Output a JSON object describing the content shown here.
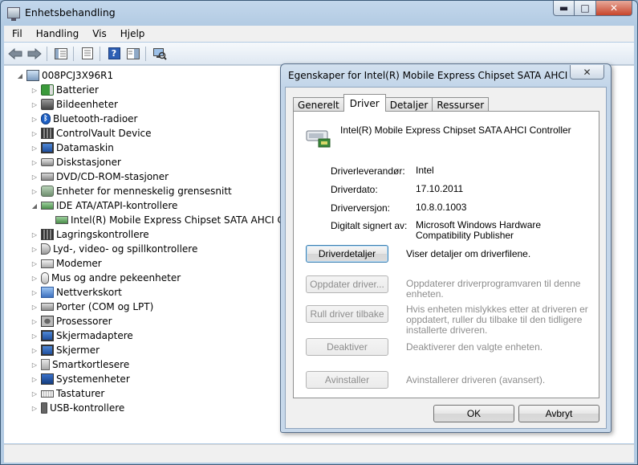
{
  "window": {
    "title": "Enhetsbehandling",
    "controls": {
      "minimize": "▬",
      "maximize": "□",
      "close": "✕"
    }
  },
  "menu": [
    "Fil",
    "Handling",
    "Vis",
    "Hjelp"
  ],
  "toolbar": [
    "back-arrow-icon",
    "forward-arrow-icon",
    "console-tree-icon",
    "properties-icon",
    "help-icon",
    "action-pane-icon",
    "scan-hardware-icon"
  ],
  "tree": {
    "root": "008PCJ3X96R1",
    "items": [
      {
        "label": "Batterier",
        "icon": "battery-icon"
      },
      {
        "label": "Bildeenheter",
        "icon": "camera-icon"
      },
      {
        "label": "Bluetooth-radioer",
        "icon": "bluetooth-icon"
      },
      {
        "label": "ControlVault Device",
        "icon": "chip-icon"
      },
      {
        "label": "Datamaskin",
        "icon": "monitor-icon"
      },
      {
        "label": "Diskstasjoner",
        "icon": "disk-drive-icon"
      },
      {
        "label": "DVD/CD-ROM-stasjoner",
        "icon": "dvd-drive-icon"
      },
      {
        "label": "Enheter for menneskelig grensesnitt",
        "icon": "hid-icon"
      },
      {
        "label": "IDE ATA/ATAPI-kontrollere",
        "icon": "ide-controller-icon",
        "expanded": true
      },
      {
        "label": "Intel(R) Mobile Express Chipset SATA AHCI Controller",
        "icon": "sata-controller-icon",
        "child": true
      },
      {
        "label": "Lagringskontrollere",
        "icon": "storage-controller-icon"
      },
      {
        "label": "Lyd-, video- og spillkontrollere",
        "icon": "speaker-icon"
      },
      {
        "label": "Modemer",
        "icon": "modem-icon"
      },
      {
        "label": "Mus og andre pekeenheter",
        "icon": "mouse-icon"
      },
      {
        "label": "Nettverkskort",
        "icon": "network-adapter-icon"
      },
      {
        "label": "Porter (COM og LPT)",
        "icon": "port-icon"
      },
      {
        "label": "Prosessorer",
        "icon": "processor-icon"
      },
      {
        "label": "Skjermadaptere",
        "icon": "display-adapter-icon"
      },
      {
        "label": "Skjermer",
        "icon": "monitor-icon"
      },
      {
        "label": "Smartkortlesere",
        "icon": "smartcard-reader-icon"
      },
      {
        "label": "Systemenheter",
        "icon": "system-devices-icon"
      },
      {
        "label": "Tastaturer",
        "icon": "keyboard-icon"
      },
      {
        "label": "USB-kontrollere",
        "icon": "usb-icon"
      }
    ]
  },
  "dialog": {
    "title": "Egenskaper for Intel(R) Mobile Express Chipset SATA AHCI Cont...",
    "close": "✕",
    "tabs": [
      "Generelt",
      "Driver",
      "Detaljer",
      "Ressurser"
    ],
    "active_tab": "Driver",
    "device_name": "Intel(R) Mobile Express Chipset SATA AHCI Controller",
    "properties": [
      {
        "label": "Driverleverandør:",
        "value": "Intel"
      },
      {
        "label": "Driverdato:",
        "value": "17.10.2011"
      },
      {
        "label": "Driverversjon:",
        "value": "10.8.0.1003"
      },
      {
        "label": "Digitalt signert av:",
        "value": "Microsoft Windows Hardware Compatibility Publisher"
      }
    ],
    "actions": [
      {
        "button": "Driverdetaljer",
        "desc": "Viser detaljer om driverfilene.",
        "enabled": true
      },
      {
        "button": "Oppdater driver...",
        "desc": "Oppdaterer driverprogramvaren til denne enheten.",
        "enabled": false
      },
      {
        "button": "Rull driver tilbake",
        "desc": "Hvis enheten mislykkes etter at driveren er oppdatert, ruller du tilbake til den tidligere installerte driveren.",
        "enabled": false
      },
      {
        "button": "Deaktiver",
        "desc": "Deaktiverer den valgte enheten.",
        "enabled": false
      },
      {
        "button": "Avinstaller",
        "desc": "Avinstallerer driveren (avansert).",
        "enabled": false
      }
    ],
    "ok": "OK",
    "cancel": "Avbryt"
  }
}
